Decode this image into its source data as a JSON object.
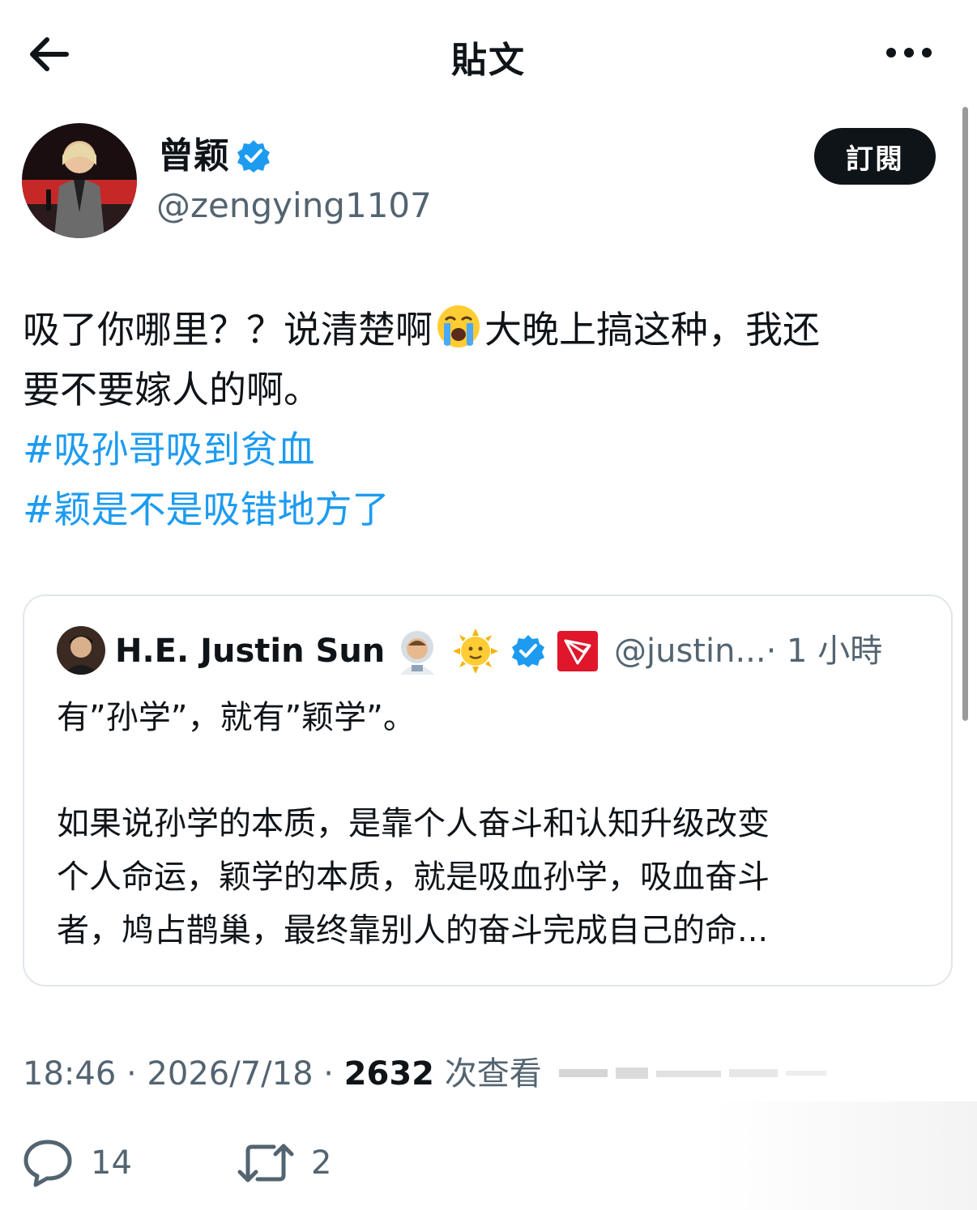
{
  "header": {
    "title": "貼文"
  },
  "author": {
    "name": "曾颖",
    "handle": "@zengying1107",
    "subscribe_label": "訂閱"
  },
  "tweet": {
    "line1_a": "吸了你哪里？？说清楚啊",
    "line1_b": "大晚上搞这种，我还",
    "line2": "要不要嫁人的啊。",
    "hashtags": [
      "#吸孙哥吸到贫血",
      "#颖是不是吸错地方了"
    ]
  },
  "quote": {
    "name": "H.E. Justin Sun",
    "handle": "@justin...",
    "time": "· 1 小時",
    "line1": "有”孙学”，就有”颖学”。",
    "body": [
      "如果说孙学的本质，是靠个人奋斗和认知升级改变",
      "个人命运，颖学的本质，就是吸血孙学，吸血奋斗",
      "者，鸠占鹊巢，最终靠别人的奋斗完成自己的命..."
    ]
  },
  "meta": {
    "time": "18:46 · 2026/7/18 · ",
    "views": "2632",
    "views_label": " 次查看"
  },
  "actions": {
    "reply_count": "14",
    "retweet_count": "2"
  },
  "colors": {
    "accent": "#1d9bf0",
    "text": "#0f1419",
    "secondary": "#536471",
    "button": "#0f1419"
  }
}
